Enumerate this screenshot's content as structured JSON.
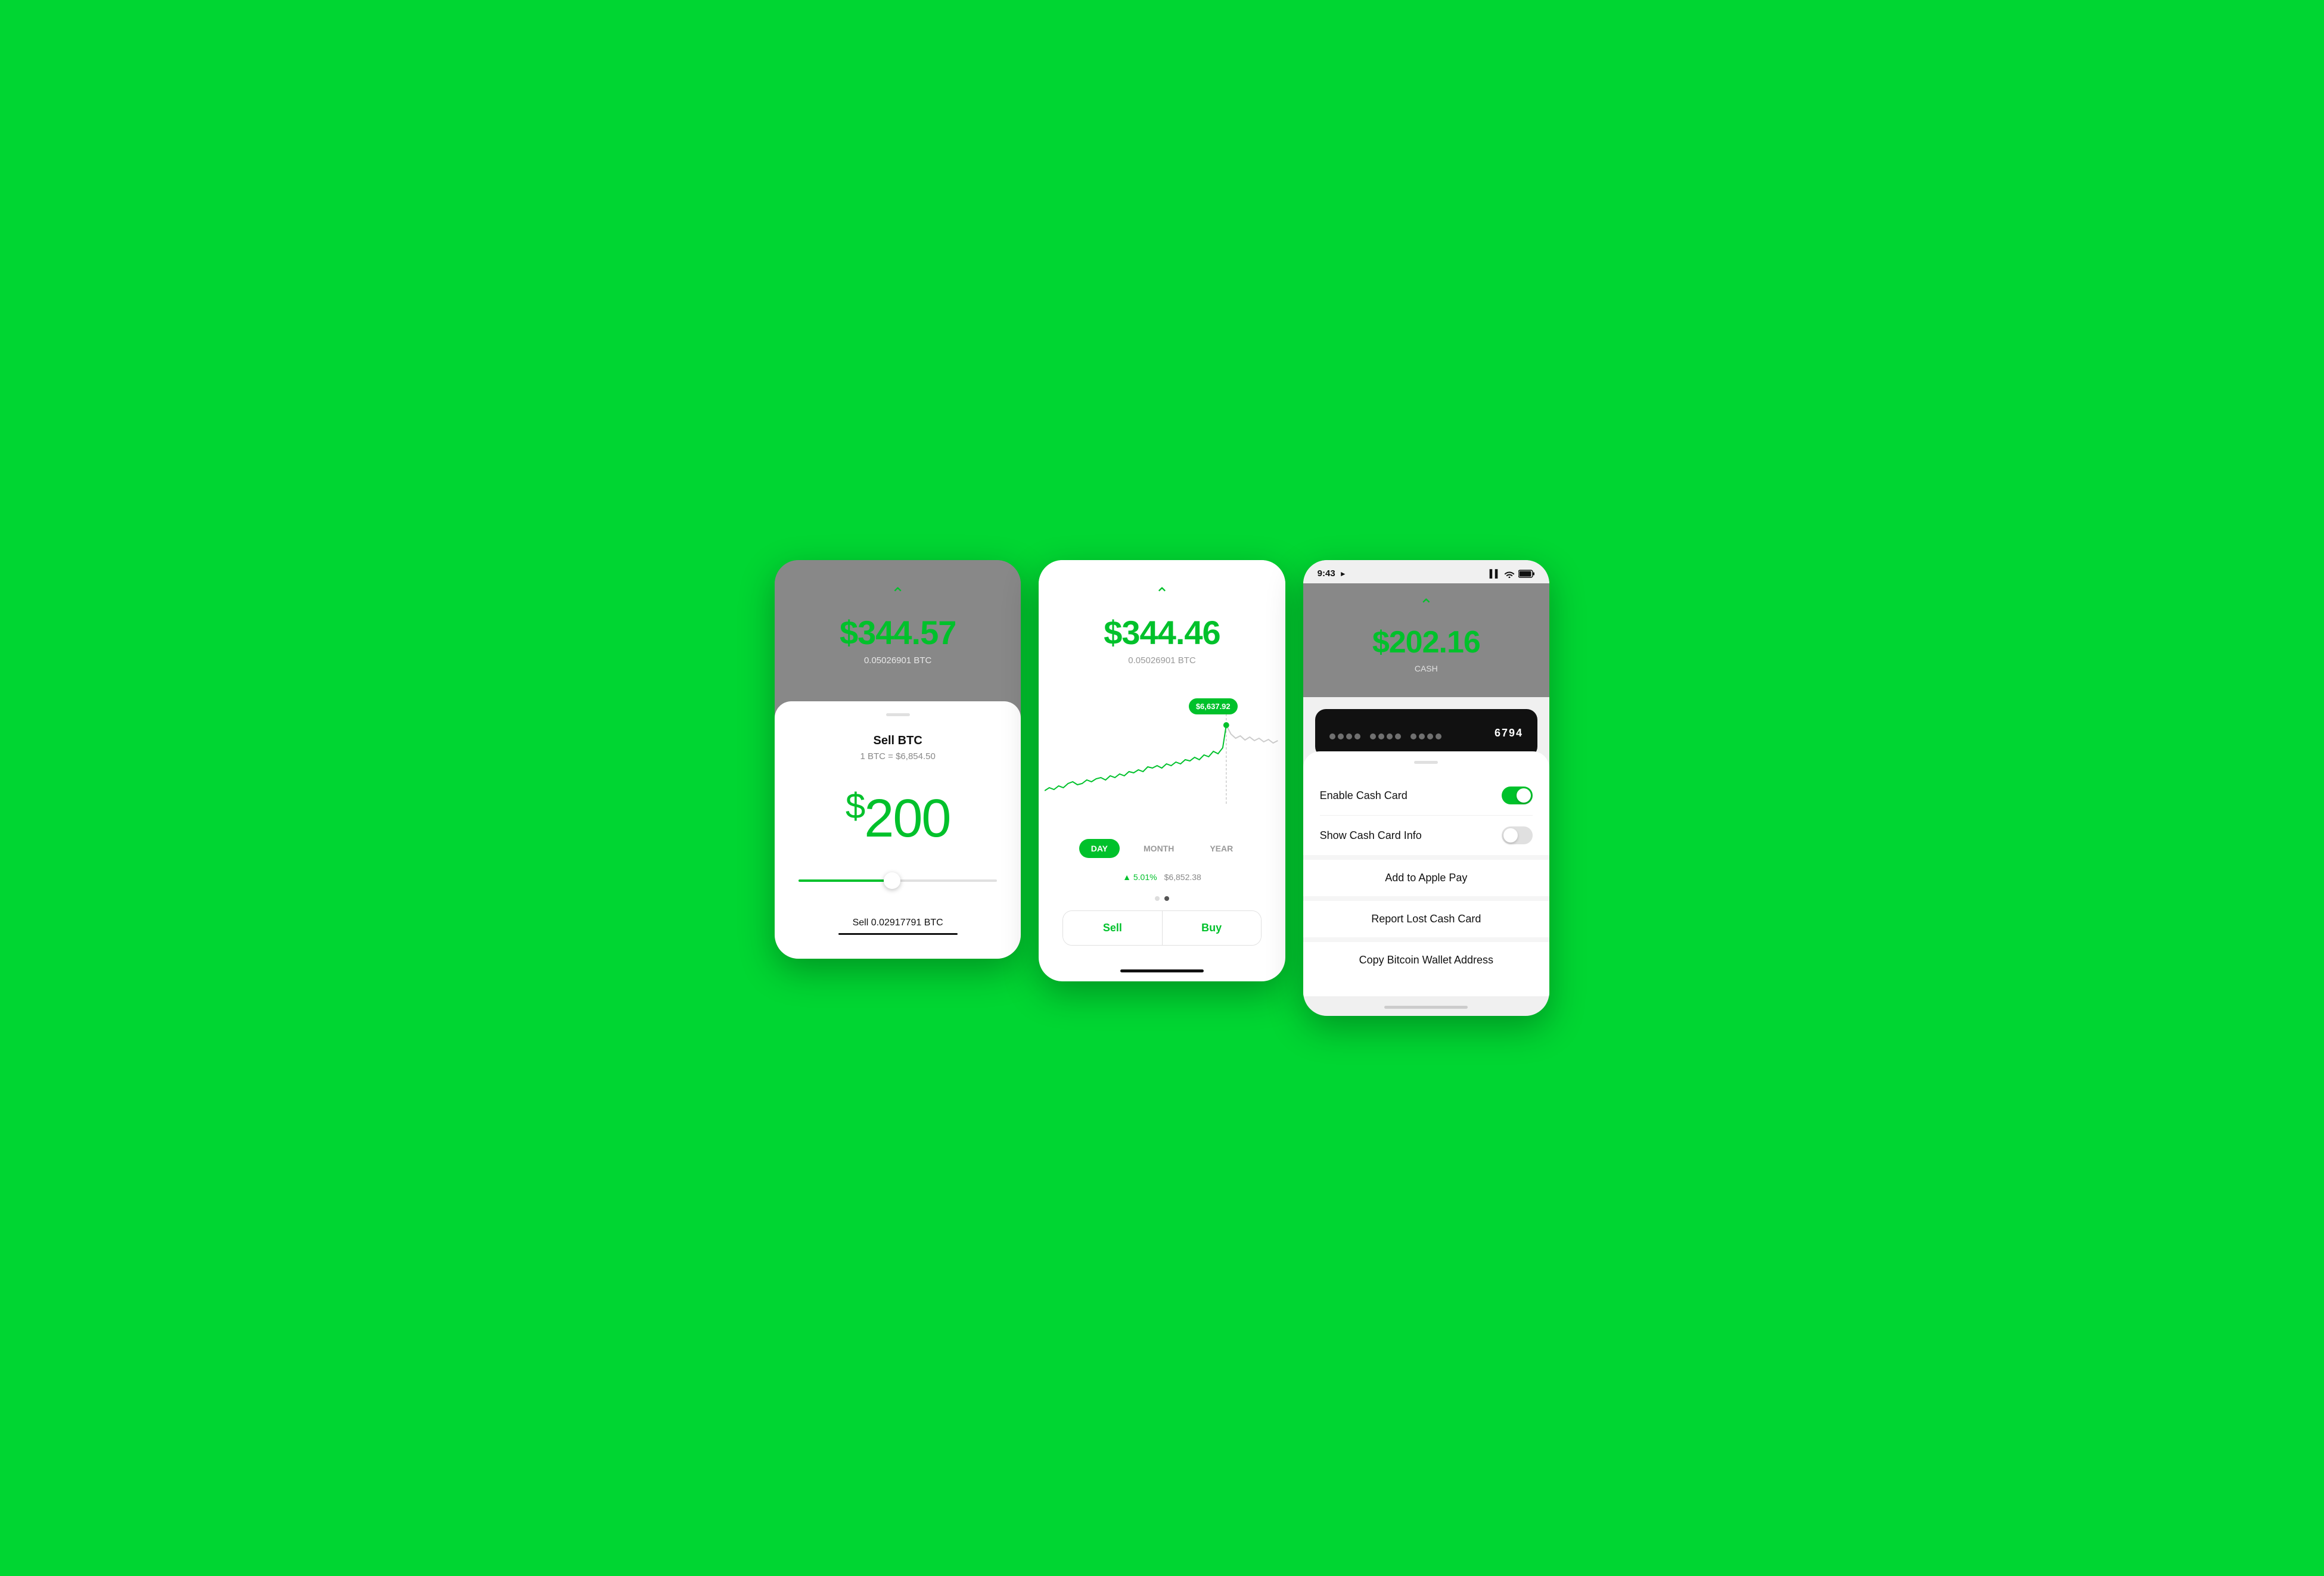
{
  "screen1": {
    "btc_balance": "$344.57",
    "btc_amount": "0.05026901 BTC",
    "sheet_handle": "",
    "sell_title": "Sell BTC",
    "sell_rate": "1 BTC = $6,854.50",
    "sell_amount_dollar": "$",
    "sell_amount_number": "200",
    "sell_bottom_label": "Sell 0.02917791 BTC"
  },
  "screen2": {
    "btc_balance": "$344.46",
    "btc_amount": "0.05026901 BTC",
    "chart_tooltip": "$6,637.92",
    "chart_controls": {
      "day": "DAY",
      "month": "MONTH",
      "year": "YEAR"
    },
    "chart_stats": {
      "change_pct": "▲ 5.01%",
      "price": "$6,852.38"
    },
    "sell_label": "Sell",
    "buy_label": "Buy"
  },
  "screen3": {
    "status_bar": {
      "time": "9:43",
      "location_icon": "▶",
      "signal": "▌▌",
      "wifi": "wifi",
      "battery": "🔋"
    },
    "cash_balance": "$202.16",
    "cash_label": "CASH",
    "card_last4": "6794",
    "enable_cash_card_label": "Enable Cash Card",
    "show_cash_card_info_label": "Show Cash Card Info",
    "add_to_apple_pay_label": "Add to Apple Pay",
    "report_lost_label": "Report Lost Cash Card",
    "copy_bitcoin_label": "Copy Bitcoin Wallet Address"
  }
}
